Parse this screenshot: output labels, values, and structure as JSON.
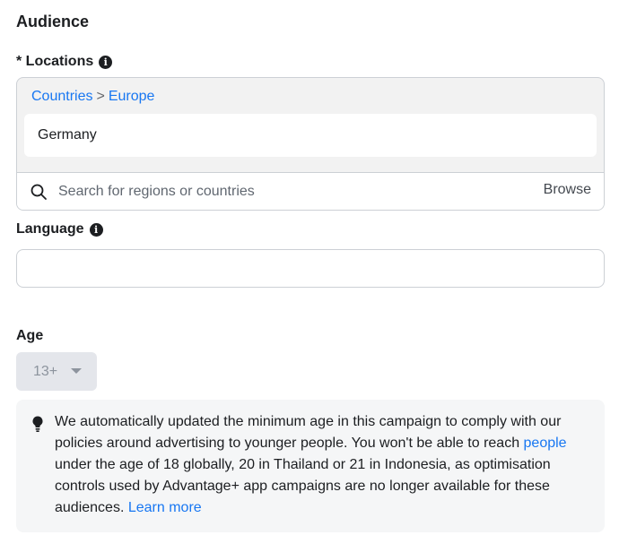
{
  "section": {
    "title": "Audience"
  },
  "locations": {
    "label": "* Locations",
    "info_icon": "info-icon",
    "breadcrumb": {
      "countries": "Countries",
      "separator": ">",
      "europe": "Europe"
    },
    "selected_item": "Germany",
    "search": {
      "placeholder": "Search for regions or countries",
      "value": ""
    },
    "browse_label": "Browse"
  },
  "language": {
    "label": "Language",
    "info_icon": "info-icon",
    "value": ""
  },
  "age": {
    "label": "Age",
    "selected_value": "13+"
  },
  "notice": {
    "icon": "lightbulb-icon",
    "text_part1": "We automatically updated the minimum age in this campaign to comply with our policies around advertising to younger people. You won't be able to reach ",
    "link_people": "people",
    "text_part2": " under the age of 18 globally, 20 in Thailand or 21 in Indonesia, as optimisation controls used by Advantage+ app campaigns are no longer available for these audiences. ",
    "link_learn_more": "Learn more"
  },
  "colors": {
    "link": "#1877f2",
    "text": "#1c1e21",
    "border": "#ccd0d5",
    "panel_bg": "#f2f2f2",
    "notice_bg": "#f5f6f7"
  }
}
